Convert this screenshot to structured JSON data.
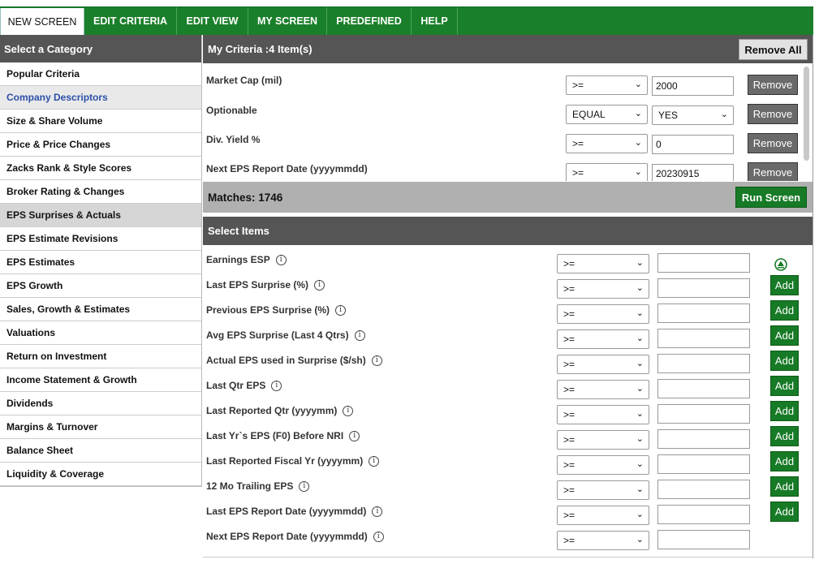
{
  "tabs": [
    {
      "label": "NEW SCREEN",
      "active": true
    },
    {
      "label": "EDIT CRITERIA",
      "active": false
    },
    {
      "label": "EDIT VIEW",
      "active": false
    },
    {
      "label": "MY SCREEN",
      "active": false
    },
    {
      "label": "PREDEFINED",
      "active": false
    },
    {
      "label": "HELP",
      "active": false
    }
  ],
  "sidebar": {
    "header": "Select a Category",
    "items": [
      "Popular Criteria",
      "Company Descriptors",
      "Size & Share Volume",
      "Price & Price Changes",
      "Zacks Rank & Style Scores",
      "Broker Rating & Changes",
      "EPS Surprises & Actuals",
      "EPS Estimate Revisions",
      "EPS Estimates",
      "EPS Growth",
      "Sales, Growth & Estimates",
      "Valuations",
      "Return on Investment",
      "Income Statement & Growth",
      "Dividends",
      "Margins & Turnover",
      "Balance Sheet",
      "Liquidity & Coverage"
    ],
    "selected": "Company Descriptors",
    "highlighted": "EPS Surprises & Actuals"
  },
  "criteria": {
    "header": "My Criteria :4 Item(s)",
    "remove_all_label": "Remove All",
    "remove_label": "Remove",
    "rows": [
      {
        "label": "Market Cap (mil)",
        "operator": ">=",
        "value": "2000",
        "value_is_select": false
      },
      {
        "label": "Optionable",
        "operator": "EQUAL",
        "value": "YES",
        "value_is_select": true
      },
      {
        "label": "Div. Yield %",
        "operator": ">=",
        "value": "0",
        "value_is_select": false
      },
      {
        "label": "Next EPS Report Date (yyyymmdd)",
        "operator": ">=",
        "value": "20230915",
        "value_is_select": false
      }
    ]
  },
  "matches": {
    "label": "Matches: 1746",
    "run_label": "Run Screen"
  },
  "select_items": {
    "header": "Select Items",
    "operator_default": ">=",
    "add_label": "Add",
    "info_glyph": "i",
    "rows": [
      {
        "label": "Earnings ESP",
        "action": "up-icon"
      },
      {
        "label": "Last EPS Surprise (%)",
        "action": "add"
      },
      {
        "label": "Previous EPS Surprise (%)",
        "action": "add"
      },
      {
        "label": "Avg EPS Surprise (Last 4 Qtrs)",
        "action": "add"
      },
      {
        "label": "Actual EPS used in Surprise ($/sh)",
        "action": "add"
      },
      {
        "label": "Last Qtr EPS",
        "action": "add"
      },
      {
        "label": "Last Reported Qtr (yyyymm)",
        "action": "add"
      },
      {
        "label": "Last Yr`s EPS (F0) Before NRI",
        "action": "add"
      },
      {
        "label": "Last Reported Fiscal Yr (yyyymm)",
        "action": "add"
      },
      {
        "label": "12 Mo Trailing EPS",
        "action": "add"
      },
      {
        "label": "Last EPS Report Date (yyyymmdd)",
        "action": "add"
      },
      {
        "label": "Next EPS Report Date (yyyymmdd)",
        "action": "none"
      }
    ]
  },
  "colors": {
    "tab_green": "#1a7f2a",
    "button_green": "#177a26",
    "header_gray": "#555555",
    "matches_gray": "#b0b0b0",
    "remove_gray": "#6a6a6a"
  }
}
